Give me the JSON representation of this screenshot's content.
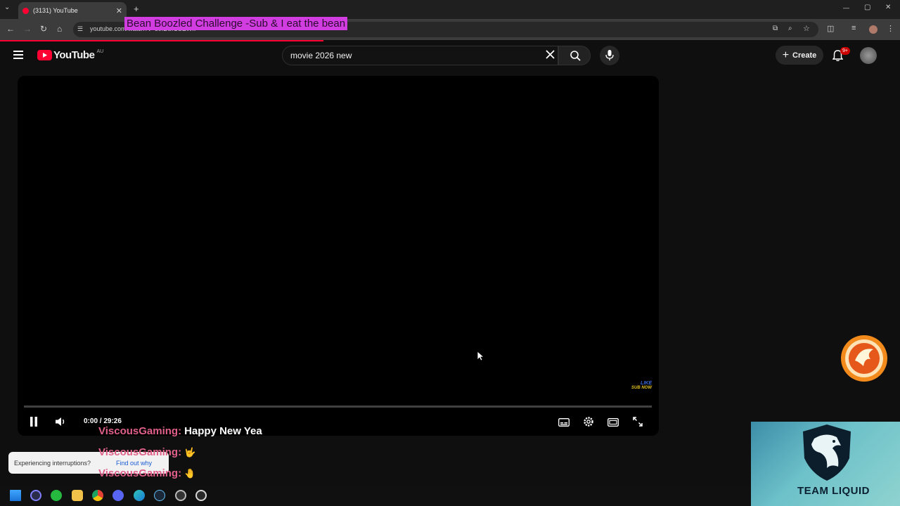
{
  "browser": {
    "tab_title": "(3131) YouTube",
    "new_tab": "+",
    "tab_close": "✕",
    "url": "youtube.com/watch?v=s0IDbICSEWk",
    "window_min": "—",
    "window_max": "▢",
    "window_close": "✕"
  },
  "stream_overlay": {
    "title": "Bean Boozled Challenge -Sub & I eat the bean"
  },
  "youtube": {
    "logo_text": "YouTube",
    "region": "AU",
    "search_value": "movie 2026 new",
    "create_label": "Create",
    "notifications_badge": "9+"
  },
  "player": {
    "time": "0:00 / 29:26",
    "progress": 0.0,
    "likesub_line1": "LIKE",
    "likesub_line2": "SUB NOW"
  },
  "chat": [
    {
      "user": "ViscousGaming:",
      "message": "Happy New Yea"
    },
    {
      "user": "ViscousGaming:",
      "message": "🤟"
    },
    {
      "user": "ViscousGaming:",
      "message": "🤚"
    }
  ],
  "toast": {
    "text": "Experiencing interruptions?",
    "link": "Find out why"
  },
  "team": {
    "name": "TEAM LIQUID"
  },
  "colors": {
    "accent": "#ff0033",
    "overlay_bg": "#d13de0",
    "chat_user": "#e0608a"
  }
}
